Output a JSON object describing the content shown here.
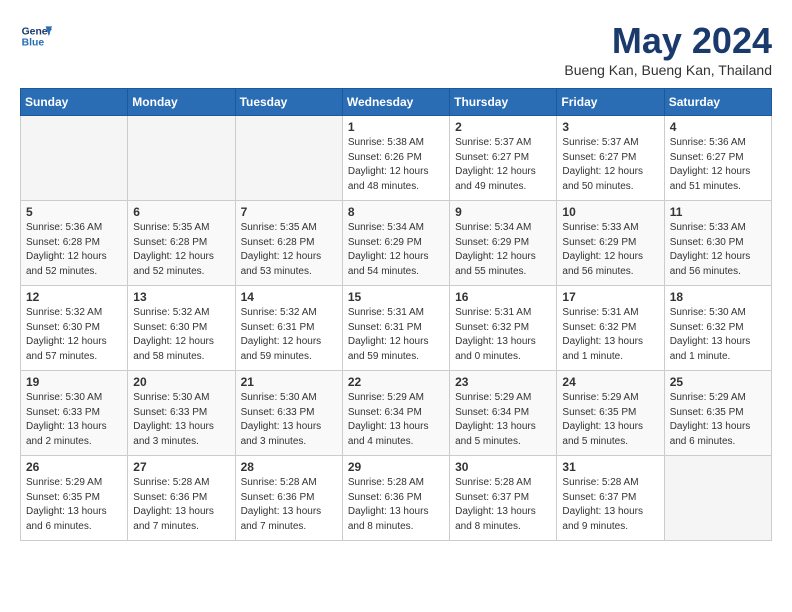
{
  "header": {
    "logo_line1": "General",
    "logo_line2": "Blue",
    "month_title": "May 2024",
    "location": "Bueng Kan, Bueng Kan, Thailand"
  },
  "weekdays": [
    "Sunday",
    "Monday",
    "Tuesday",
    "Wednesday",
    "Thursday",
    "Friday",
    "Saturday"
  ],
  "weeks": [
    [
      {
        "day": "",
        "empty": true
      },
      {
        "day": "",
        "empty": true
      },
      {
        "day": "",
        "empty": true
      },
      {
        "day": "1",
        "sunrise": "5:38 AM",
        "sunset": "6:26 PM",
        "daylight": "12 hours and 48 minutes."
      },
      {
        "day": "2",
        "sunrise": "5:37 AM",
        "sunset": "6:27 PM",
        "daylight": "12 hours and 49 minutes."
      },
      {
        "day": "3",
        "sunrise": "5:37 AM",
        "sunset": "6:27 PM",
        "daylight": "12 hours and 50 minutes."
      },
      {
        "day": "4",
        "sunrise": "5:36 AM",
        "sunset": "6:27 PM",
        "daylight": "12 hours and 51 minutes."
      }
    ],
    [
      {
        "day": "5",
        "sunrise": "5:36 AM",
        "sunset": "6:28 PM",
        "daylight": "12 hours and 52 minutes."
      },
      {
        "day": "6",
        "sunrise": "5:35 AM",
        "sunset": "6:28 PM",
        "daylight": "12 hours and 52 minutes."
      },
      {
        "day": "7",
        "sunrise": "5:35 AM",
        "sunset": "6:28 PM",
        "daylight": "12 hours and 53 minutes."
      },
      {
        "day": "8",
        "sunrise": "5:34 AM",
        "sunset": "6:29 PM",
        "daylight": "12 hours and 54 minutes."
      },
      {
        "day": "9",
        "sunrise": "5:34 AM",
        "sunset": "6:29 PM",
        "daylight": "12 hours and 55 minutes."
      },
      {
        "day": "10",
        "sunrise": "5:33 AM",
        "sunset": "6:29 PM",
        "daylight": "12 hours and 56 minutes."
      },
      {
        "day": "11",
        "sunrise": "5:33 AM",
        "sunset": "6:30 PM",
        "daylight": "12 hours and 56 minutes."
      }
    ],
    [
      {
        "day": "12",
        "sunrise": "5:32 AM",
        "sunset": "6:30 PM",
        "daylight": "12 hours and 57 minutes."
      },
      {
        "day": "13",
        "sunrise": "5:32 AM",
        "sunset": "6:30 PM",
        "daylight": "12 hours and 58 minutes."
      },
      {
        "day": "14",
        "sunrise": "5:32 AM",
        "sunset": "6:31 PM",
        "daylight": "12 hours and 59 minutes."
      },
      {
        "day": "15",
        "sunrise": "5:31 AM",
        "sunset": "6:31 PM",
        "daylight": "12 hours and 59 minutes."
      },
      {
        "day": "16",
        "sunrise": "5:31 AM",
        "sunset": "6:32 PM",
        "daylight": "13 hours and 0 minutes."
      },
      {
        "day": "17",
        "sunrise": "5:31 AM",
        "sunset": "6:32 PM",
        "daylight": "13 hours and 1 minute."
      },
      {
        "day": "18",
        "sunrise": "5:30 AM",
        "sunset": "6:32 PM",
        "daylight": "13 hours and 1 minute."
      }
    ],
    [
      {
        "day": "19",
        "sunrise": "5:30 AM",
        "sunset": "6:33 PM",
        "daylight": "13 hours and 2 minutes."
      },
      {
        "day": "20",
        "sunrise": "5:30 AM",
        "sunset": "6:33 PM",
        "daylight": "13 hours and 3 minutes."
      },
      {
        "day": "21",
        "sunrise": "5:30 AM",
        "sunset": "6:33 PM",
        "daylight": "13 hours and 3 minutes."
      },
      {
        "day": "22",
        "sunrise": "5:29 AM",
        "sunset": "6:34 PM",
        "daylight": "13 hours and 4 minutes."
      },
      {
        "day": "23",
        "sunrise": "5:29 AM",
        "sunset": "6:34 PM",
        "daylight": "13 hours and 5 minutes."
      },
      {
        "day": "24",
        "sunrise": "5:29 AM",
        "sunset": "6:35 PM",
        "daylight": "13 hours and 5 minutes."
      },
      {
        "day": "25",
        "sunrise": "5:29 AM",
        "sunset": "6:35 PM",
        "daylight": "13 hours and 6 minutes."
      }
    ],
    [
      {
        "day": "26",
        "sunrise": "5:29 AM",
        "sunset": "6:35 PM",
        "daylight": "13 hours and 6 minutes."
      },
      {
        "day": "27",
        "sunrise": "5:28 AM",
        "sunset": "6:36 PM",
        "daylight": "13 hours and 7 minutes."
      },
      {
        "day": "28",
        "sunrise": "5:28 AM",
        "sunset": "6:36 PM",
        "daylight": "13 hours and 7 minutes."
      },
      {
        "day": "29",
        "sunrise": "5:28 AM",
        "sunset": "6:36 PM",
        "daylight": "13 hours and 8 minutes."
      },
      {
        "day": "30",
        "sunrise": "5:28 AM",
        "sunset": "6:37 PM",
        "daylight": "13 hours and 8 minutes."
      },
      {
        "day": "31",
        "sunrise": "5:28 AM",
        "sunset": "6:37 PM",
        "daylight": "13 hours and 9 minutes."
      },
      {
        "day": "",
        "empty": true
      }
    ]
  ]
}
